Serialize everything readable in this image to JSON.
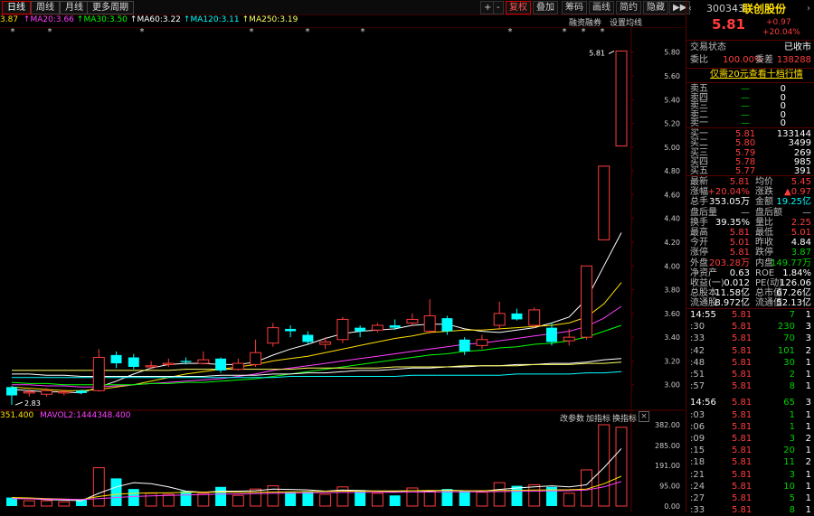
{
  "toolbar": {
    "tabs": [
      "日线",
      "周线",
      "月线",
      "更多周期"
    ],
    "right_buttons": [
      "+",
      "-",
      "复权",
      "叠加",
      "筹码",
      "画线",
      "简约",
      "隐藏",
      "▶▶"
    ],
    "sub_links": [
      "融资融券",
      "设置均线"
    ]
  },
  "ma_line": {
    "first": "3.87",
    "items": [
      {
        "label": "MA20:3.66",
        "color": "#ff40ff"
      },
      {
        "label": "MA30:3.50",
        "color": "#00ff00"
      },
      {
        "label": "MA60:3.22",
        "color": "#ffffff"
      },
      {
        "label": "MA120:3.11",
        "color": "#00ffff"
      },
      {
        "label": "MA250:3.19",
        "color": "#ffff60"
      }
    ]
  },
  "volume_line": {
    "first": "351.400",
    "label": "MAVOL2:1444348.400"
  },
  "vol_links": [
    "改参数",
    "加指标",
    "换指标"
  ],
  "chart_data": {
    "type": "candlestick",
    "ylim": [
      2.8,
      5.95
    ],
    "price_ticks": [
      "5.80",
      "5.60",
      "5.40",
      "5.20",
      "5.00",
      "4.80",
      "4.60",
      "4.40",
      "4.20",
      "4.00",
      "3.80",
      "3.60",
      "3.40",
      "3.20",
      "3.00"
    ],
    "vol_ticks": [
      "382.00",
      "285.00",
      "191.00",
      "95.00",
      "0.00"
    ],
    "high_label": "5.81",
    "low_label": "2.83",
    "candles": [
      {
        "o": 2.98,
        "c": 2.91,
        "h": 2.99,
        "l": 2.83,
        "v": 40
      },
      {
        "o": 2.93,
        "c": 2.94,
        "h": 2.96,
        "l": 2.9,
        "v": 25
      },
      {
        "o": 2.92,
        "c": 2.95,
        "h": 2.97,
        "l": 2.9,
        "v": 25
      },
      {
        "o": 2.93,
        "c": 2.94,
        "h": 2.96,
        "l": 2.91,
        "v": 20
      },
      {
        "o": 2.95,
        "c": 2.93,
        "h": 2.96,
        "l": 2.92,
        "v": 30
      },
      {
        "o": 2.95,
        "c": 3.23,
        "h": 3.3,
        "l": 2.94,
        "v": 180
      },
      {
        "o": 3.25,
        "c": 3.18,
        "h": 3.28,
        "l": 3.14,
        "v": 130
      },
      {
        "o": 3.23,
        "c": 3.15,
        "h": 3.26,
        "l": 3.13,
        "v": 80
      },
      {
        "o": 3.15,
        "c": 3.16,
        "h": 3.2,
        "l": 3.13,
        "v": 60
      },
      {
        "o": 3.17,
        "c": 3.18,
        "h": 3.22,
        "l": 3.15,
        "v": 55
      },
      {
        "o": 3.2,
        "c": 3.19,
        "h": 3.23,
        "l": 3.17,
        "v": 70
      },
      {
        "o": 3.18,
        "c": 3.21,
        "h": 3.28,
        "l": 3.17,
        "v": 60
      },
      {
        "o": 3.22,
        "c": 3.12,
        "h": 3.23,
        "l": 3.1,
        "v": 90
      },
      {
        "o": 3.13,
        "c": 3.18,
        "h": 3.22,
        "l": 3.12,
        "v": 50
      },
      {
        "o": 3.17,
        "c": 3.27,
        "h": 3.38,
        "l": 3.15,
        "v": 80
      },
      {
        "o": 3.35,
        "c": 3.48,
        "h": 3.52,
        "l": 3.32,
        "v": 95
      },
      {
        "o": 3.47,
        "c": 3.45,
        "h": 3.5,
        "l": 3.4,
        "v": 65
      },
      {
        "o": 3.42,
        "c": 3.36,
        "h": 3.45,
        "l": 3.34,
        "v": 70
      },
      {
        "o": 3.34,
        "c": 3.36,
        "h": 3.4,
        "l": 3.3,
        "v": 55
      },
      {
        "o": 3.38,
        "c": 3.55,
        "h": 3.57,
        "l": 3.35,
        "v": 90
      },
      {
        "o": 3.48,
        "c": 3.45,
        "h": 3.5,
        "l": 3.4,
        "v": 75
      },
      {
        "o": 3.46,
        "c": 3.5,
        "h": 3.52,
        "l": 3.44,
        "v": 60
      },
      {
        "o": 3.5,
        "c": 3.48,
        "h": 3.55,
        "l": 3.46,
        "v": 50
      },
      {
        "o": 3.52,
        "c": 3.55,
        "h": 3.6,
        "l": 3.5,
        "v": 85
      },
      {
        "o": 3.45,
        "c": 3.58,
        "h": 3.72,
        "l": 3.43,
        "v": 70
      },
      {
        "o": 3.56,
        "c": 3.45,
        "h": 3.58,
        "l": 3.42,
        "v": 80
      },
      {
        "o": 3.38,
        "c": 3.28,
        "h": 3.4,
        "l": 3.25,
        "v": 70
      },
      {
        "o": 3.33,
        "c": 3.38,
        "h": 3.42,
        "l": 3.3,
        "v": 65
      },
      {
        "o": 3.5,
        "c": 3.6,
        "h": 3.7,
        "l": 3.46,
        "v": 110
      },
      {
        "o": 3.6,
        "c": 3.55,
        "h": 3.64,
        "l": 3.54,
        "v": 95
      },
      {
        "o": 3.5,
        "c": 3.63,
        "h": 3.65,
        "l": 3.48,
        "v": 100
      },
      {
        "o": 3.48,
        "c": 3.36,
        "h": 3.52,
        "l": 3.33,
        "v": 90
      },
      {
        "o": 3.37,
        "c": 3.4,
        "h": 3.47,
        "l": 3.33,
        "v": 60
      },
      {
        "o": 3.4,
        "c": 4.0,
        "h": 4.0,
        "l": 3.38,
        "v": 170
      },
      {
        "o": 4.22,
        "c": 4.84,
        "h": 4.84,
        "l": 4.25,
        "v": 382
      },
      {
        "o": 5.01,
        "c": 5.81,
        "h": 5.81,
        "l": 5.01,
        "v": 370
      }
    ],
    "ma_series": [
      {
        "name": "MA5",
        "color": "#ffffff",
        "values": [
          2.96,
          2.95,
          2.94,
          2.94,
          2.93,
          2.98,
          3.03,
          3.09,
          3.14,
          3.17,
          3.18,
          3.18,
          3.17,
          3.17,
          3.19,
          3.25,
          3.3,
          3.34,
          3.39,
          3.43,
          3.45,
          3.46,
          3.47,
          3.5,
          3.51,
          3.51,
          3.47,
          3.45,
          3.44,
          3.46,
          3.48,
          3.52,
          3.57,
          3.72,
          4.0,
          4.28
        ]
      },
      {
        "name": "MA10",
        "color": "#ffe000",
        "values": [
          2.98,
          2.97,
          2.96,
          2.95,
          2.95,
          2.96,
          2.98,
          3.0,
          3.03,
          3.06,
          3.09,
          3.11,
          3.13,
          3.15,
          3.17,
          3.2,
          3.22,
          3.24,
          3.27,
          3.3,
          3.33,
          3.36,
          3.39,
          3.41,
          3.44,
          3.45,
          3.46,
          3.46,
          3.47,
          3.48,
          3.49,
          3.5,
          3.52,
          3.57,
          3.68,
          3.86
        ]
      },
      {
        "name": "MA20",
        "color": "#ff40ff",
        "values": [
          3.0,
          3.0,
          2.99,
          2.99,
          2.98,
          2.98,
          2.99,
          3.0,
          3.01,
          3.02,
          3.03,
          3.04,
          3.05,
          3.07,
          3.09,
          3.12,
          3.14,
          3.16,
          3.18,
          3.2,
          3.22,
          3.24,
          3.26,
          3.28,
          3.3,
          3.32,
          3.34,
          3.35,
          3.37,
          3.39,
          3.41,
          3.43,
          3.45,
          3.49,
          3.56,
          3.66
        ]
      },
      {
        "name": "MA30",
        "color": "#00ff00",
        "values": [
          3.02,
          3.01,
          3.01,
          3.0,
          3.0,
          3.0,
          3.0,
          3.0,
          3.01,
          3.01,
          3.02,
          3.02,
          3.03,
          3.04,
          3.05,
          3.07,
          3.09,
          3.11,
          3.13,
          3.15,
          3.17,
          3.19,
          3.21,
          3.23,
          3.25,
          3.26,
          3.28,
          3.29,
          3.31,
          3.32,
          3.34,
          3.35,
          3.37,
          3.4,
          3.45,
          3.5
        ]
      },
      {
        "name": "MA60",
        "color": "#ffffff",
        "values": [
          3.09,
          3.09,
          3.08,
          3.08,
          3.07,
          3.07,
          3.07,
          3.07,
          3.07,
          3.07,
          3.07,
          3.07,
          3.08,
          3.08,
          3.08,
          3.09,
          3.09,
          3.1,
          3.1,
          3.11,
          3.12,
          3.12,
          3.13,
          3.14,
          3.14,
          3.15,
          3.15,
          3.16,
          3.16,
          3.17,
          3.17,
          3.18,
          3.18,
          3.19,
          3.21,
          3.22
        ]
      },
      {
        "name": "MA120",
        "color": "#00ffff",
        "values": [
          3.06,
          3.06,
          3.06,
          3.06,
          3.06,
          3.06,
          3.06,
          3.06,
          3.06,
          3.06,
          3.06,
          3.06,
          3.06,
          3.06,
          3.06,
          3.06,
          3.07,
          3.07,
          3.07,
          3.07,
          3.07,
          3.07,
          3.07,
          3.08,
          3.08,
          3.08,
          3.08,
          3.08,
          3.08,
          3.09,
          3.09,
          3.09,
          3.09,
          3.1,
          3.1,
          3.11
        ]
      },
      {
        "name": "MA250",
        "color": "#ffff60",
        "values": [
          3.12,
          3.12,
          3.12,
          3.12,
          3.12,
          3.12,
          3.12,
          3.12,
          3.12,
          3.12,
          3.13,
          3.13,
          3.13,
          3.13,
          3.13,
          3.13,
          3.13,
          3.14,
          3.14,
          3.14,
          3.14,
          3.14,
          3.15,
          3.15,
          3.15,
          3.15,
          3.16,
          3.16,
          3.16,
          3.16,
          3.17,
          3.17,
          3.17,
          3.18,
          3.18,
          3.19
        ]
      }
    ],
    "vol_ma": [
      {
        "color": "#ffffff",
        "values": [
          40,
          35,
          30,
          28,
          25,
          60,
          90,
          110,
          105,
          90,
          70,
          65,
          70,
          70,
          72,
          80,
          78,
          76,
          70,
          75,
          73,
          70,
          68,
          72,
          70,
          75,
          72,
          70,
          78,
          85,
          90,
          95,
          90,
          100,
          180,
          270
        ]
      },
      {
        "color": "#ffe000",
        "values": [
          40,
          38,
          35,
          33,
          30,
          45,
          55,
          60,
          62,
          62,
          65,
          65,
          66,
          65,
          65,
          66,
          67,
          68,
          69,
          70,
          70,
          71,
          71,
          72,
          73,
          73,
          72,
          72,
          73,
          74,
          75,
          76,
          77,
          80,
          105,
          140
        ]
      },
      {
        "color": "#ff40ff",
        "values": [
          35,
          34,
          33,
          32,
          31,
          35,
          40,
          45,
          48,
          50,
          52,
          54,
          56,
          57,
          58,
          60,
          61,
          62,
          63,
          64,
          64,
          65,
          65,
          66,
          66,
          67,
          67,
          67,
          68,
          69,
          70,
          71,
          72,
          75,
          90,
          115
        ]
      }
    ]
  },
  "stock": {
    "code": "300343",
    "name": "联创股份",
    "price": "5.81",
    "change": "+0.97",
    "pct": "+20.04%"
  },
  "status": {
    "label": "交易状态",
    "value": "已收市"
  },
  "weibi": {
    "k1": "委比",
    "v1": "100.00%",
    "k2": "委差",
    "v2": "138288"
  },
  "level2_link": "仅需20元查看十档行情",
  "sell": [
    {
      "k": "卖五",
      "p": "—",
      "v": "0"
    },
    {
      "k": "卖四",
      "p": "—",
      "v": "0"
    },
    {
      "k": "卖三",
      "p": "—",
      "v": "0"
    },
    {
      "k": "卖二",
      "p": "—",
      "v": "0"
    },
    {
      "k": "卖一",
      "p": "—",
      "v": "0"
    }
  ],
  "buy": [
    {
      "k": "买一",
      "p": "5.81",
      "v": "133144"
    },
    {
      "k": "买二",
      "p": "5.80",
      "v": "3499"
    },
    {
      "k": "买三",
      "p": "5.79",
      "v": "269"
    },
    {
      "k": "买四",
      "p": "5.78",
      "v": "985"
    },
    {
      "k": "买五",
      "p": "5.77",
      "v": "391"
    }
  ],
  "quote": [
    {
      "k1": "最新",
      "v1": "5.81",
      "c1": "red",
      "k2": "均价",
      "v2": "5.45",
      "c2": "red"
    },
    {
      "k1": "涨幅",
      "v1": "+20.04%",
      "c1": "red",
      "k2": "涨跌",
      "v2": "▲0.97",
      "c2": "red"
    },
    {
      "k1": "总手",
      "v1": "353.05万",
      "c1": "wht",
      "k2": "金额",
      "v2": "19.25亿",
      "c2": "cyan"
    },
    {
      "k1": "盘后量",
      "v1": "—",
      "c1": "gry",
      "k2": "盘后额",
      "v2": "—",
      "c2": "gry"
    },
    {
      "k1": "换手",
      "v1": "39.35%",
      "c1": "wht",
      "k2": "量比",
      "v2": "2.25",
      "c2": "red"
    },
    {
      "k1": "最高",
      "v1": "5.81",
      "c1": "red",
      "k2": "最低",
      "v2": "5.01",
      "c2": "red"
    },
    {
      "k1": "今开",
      "v1": "5.01",
      "c1": "red",
      "k2": "昨收",
      "v2": "4.84",
      "c2": "wht"
    },
    {
      "k1": "涨停",
      "v1": "5.81",
      "c1": "red",
      "k2": "跌停",
      "v2": "3.87",
      "c2": "green"
    },
    {
      "k1": "外盘",
      "v1": "203.28万",
      "c1": "red",
      "k2": "内盘",
      "v2": "149.77万",
      "c2": "green"
    },
    {
      "k1": "净资产",
      "v1": "0.63",
      "c1": "wht",
      "k2": "ROE",
      "v2": "1.84%",
      "c2": "wht"
    },
    {
      "k1": "收益(一)",
      "v1": "0.012",
      "c1": "wht",
      "k2": "PE(动)",
      "v2": "126.06",
      "c2": "wht"
    },
    {
      "k1": "总股本",
      "v1": "11.58亿",
      "c1": "wht",
      "k2": "总市值",
      "v2": "67.26亿",
      "c2": "wht"
    },
    {
      "k1": "流通股",
      "v1": "8.972亿",
      "c1": "wht",
      "k2": "流通值",
      "v2": "52.13亿",
      "c2": "wht"
    }
  ],
  "ticks": [
    {
      "t": "14:55",
      "p": "5.81",
      "v": "7",
      "n": "1",
      "vc": "green"
    },
    {
      "t": ":30",
      "p": "5.81",
      "v": "230",
      "n": "3",
      "vc": "green"
    },
    {
      "t": ":33",
      "p": "5.81",
      "v": "70",
      "n": "3",
      "vc": "green"
    },
    {
      "t": ":42",
      "p": "5.81",
      "v": "101",
      "n": "2",
      "vc": "green"
    },
    {
      "t": ":48",
      "p": "5.81",
      "v": "30",
      "n": "1",
      "vc": "green"
    },
    {
      "t": ":51",
      "p": "5.81",
      "v": "2",
      "n": "1",
      "vc": "green"
    },
    {
      "t": ":57",
      "p": "5.81",
      "v": "8",
      "n": "1",
      "vc": "green"
    },
    {
      "t": "14:56",
      "p": "5.81",
      "v": "65",
      "n": "3",
      "vc": "green"
    },
    {
      "t": ":03",
      "p": "5.81",
      "v": "1",
      "n": "1",
      "vc": "green"
    },
    {
      "t": ":06",
      "p": "5.81",
      "v": "1",
      "n": "1",
      "vc": "green"
    },
    {
      "t": ":09",
      "p": "5.81",
      "v": "3",
      "n": "2",
      "vc": "green"
    },
    {
      "t": ":15",
      "p": "5.81",
      "v": "20",
      "n": "1",
      "vc": "green"
    },
    {
      "t": ":18",
      "p": "5.81",
      "v": "11",
      "n": "2",
      "vc": "green"
    },
    {
      "t": ":21",
      "p": "5.81",
      "v": "3",
      "n": "1",
      "vc": "green"
    },
    {
      "t": ":24",
      "p": "5.81",
      "v": "10",
      "n": "1",
      "vc": "green"
    },
    {
      "t": ":27",
      "p": "5.81",
      "v": "5",
      "n": "1",
      "vc": "green"
    },
    {
      "t": ":33",
      "p": "5.81",
      "v": "8",
      "n": "1",
      "vc": "green"
    }
  ]
}
